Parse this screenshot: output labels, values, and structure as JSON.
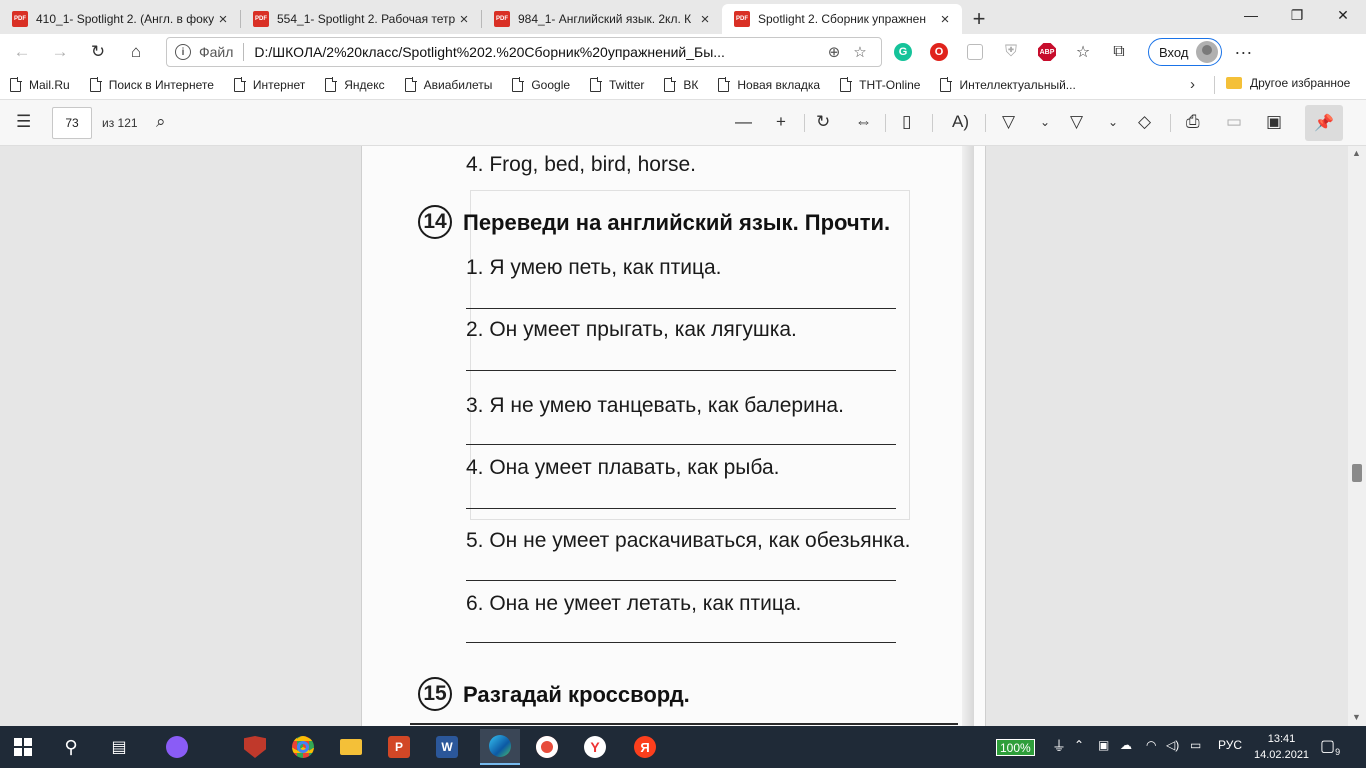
{
  "tabs": [
    {
      "title": "410_1- Spotlight 2. (Англ. в фоку",
      "active": false
    },
    {
      "title": "554_1- Spotlight 2. Рабочая тетр",
      "active": false
    },
    {
      "title": "984_1- Английский язык. 2кл. К",
      "active": false
    },
    {
      "title": "Spotlight 2. Сборник упражнен",
      "active": true
    }
  ],
  "tab_icon_label": "PDF",
  "address": {
    "protocol_label": "Файл",
    "url": "D:/ШКОЛА/2%20класс/Spotlight%202.%20Сборник%20упражнений_Бы..."
  },
  "profile": {
    "signin_label": "Вход"
  },
  "favorites": [
    {
      "label": "Mail.Ru"
    },
    {
      "label": "Поиск в Интернете"
    },
    {
      "label": "Интернет"
    },
    {
      "label": "Яндекс"
    },
    {
      "label": "Авиабилеты"
    },
    {
      "label": "Google"
    },
    {
      "label": "Twitter"
    },
    {
      "label": "ВК"
    },
    {
      "label": "Новая вкладка"
    },
    {
      "label": "THT-Online"
    },
    {
      "label": "Интеллектуальный..."
    }
  ],
  "other_favorites": "Другое избранное",
  "pdf_toolbar": {
    "page_number": "73",
    "page_total": "из 121"
  },
  "document": {
    "prev_item": "4. Frog, bed, bird, horse.",
    "exercise14": {
      "number": "14",
      "title": "Переведи на английский язык. Прочти.",
      "items": [
        "1. Я умею петь, как птица.",
        "2. Он умеет прыгать, как лягушка.",
        "3. Я не умею танцевать, как балерина.",
        "4. Она умеет плавать, как рыба.",
        "5. Он не умеет раскачиваться, как обезьянка.",
        "6. Она не умеет летать, как птица."
      ]
    },
    "exercise15": {
      "number": "15",
      "title": "Разгадай кроссворд."
    }
  },
  "taskbar": {
    "battery": "100%",
    "language": "РУС",
    "time": "13:41",
    "date": "14.02.2021",
    "notifications": "9"
  }
}
